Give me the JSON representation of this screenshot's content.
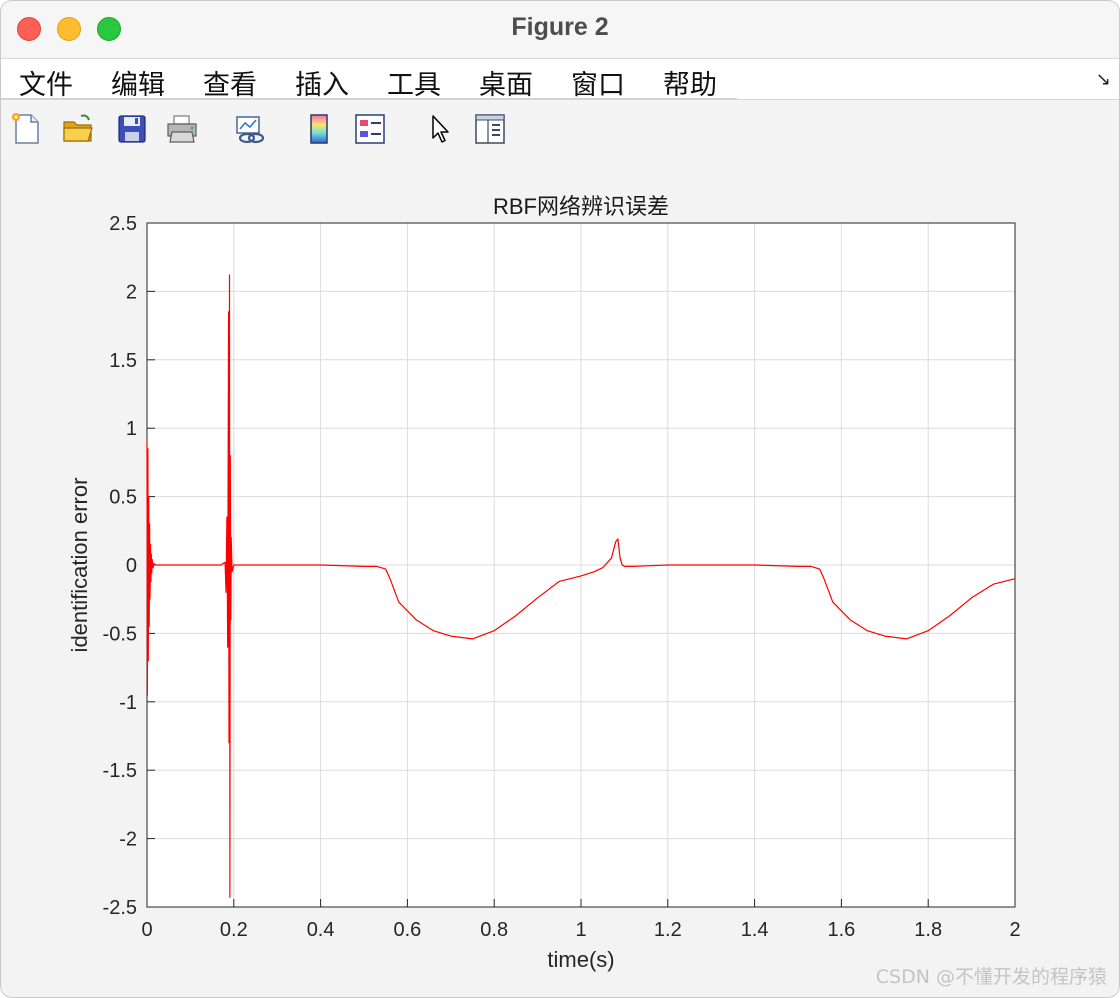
{
  "window": {
    "title": "Figure 2"
  },
  "menubar": {
    "items": [
      "文件",
      "编辑",
      "查看",
      "插入",
      "工具",
      "桌面",
      "窗口",
      "帮助"
    ],
    "corner_glyph": "↘"
  },
  "toolbar": {
    "icons": [
      "new-figure-icon",
      "open-file-icon",
      "save-icon",
      "print-icon",
      "link-plot-icon",
      "colorbar-icon",
      "legend-icon",
      "edit-plot-arrow-icon",
      "property-inspector-icon"
    ]
  },
  "watermark": "CSDN @不懂开发的程序猿",
  "chart_data": {
    "type": "line",
    "title": "RBF网络辨识误差",
    "xlabel": "time(s)",
    "ylabel": "identification error",
    "xlim": [
      0,
      2
    ],
    "ylim": [
      -2.5,
      2.5
    ],
    "xticks": [
      0,
      0.2,
      0.4,
      0.6,
      0.8,
      1,
      1.2,
      1.4,
      1.6,
      1.8,
      2
    ],
    "xtick_labels": [
      "0",
      "0.2",
      "0.4",
      "0.6",
      "0.8",
      "1",
      "1.2",
      "1.4",
      "1.6",
      "1.8",
      "2"
    ],
    "yticks": [
      -2.5,
      -2,
      -1.5,
      -1,
      -0.5,
      0,
      0.5,
      1,
      1.5,
      2,
      2.5
    ],
    "ytick_labels": [
      "-2.5",
      "-2",
      "-1.5",
      "-1",
      "-0.5",
      "0",
      "0.5",
      "1",
      "1.5",
      "2",
      "2.5"
    ],
    "grid": true,
    "series": [
      {
        "color": "#ff0000",
        "x": [
          0.0,
          0.001,
          0.002,
          0.003,
          0.004,
          0.005,
          0.006,
          0.007,
          0.008,
          0.009,
          0.01,
          0.011,
          0.012,
          0.014,
          0.016,
          0.02,
          0.05,
          0.1,
          0.17,
          0.18,
          0.182,
          0.184,
          0.186,
          0.187,
          0.188,
          0.189,
          0.19,
          0.191,
          0.192,
          0.193,
          0.194,
          0.196,
          0.2,
          0.3,
          0.4,
          0.5,
          0.53,
          0.55,
          0.56,
          0.58,
          0.62,
          0.66,
          0.7,
          0.75,
          0.8,
          0.85,
          0.9,
          0.95,
          1.0,
          1.03,
          1.05,
          1.07,
          1.08,
          1.085,
          1.09,
          1.095,
          1.1,
          1.12,
          1.2,
          1.3,
          1.4,
          1.5,
          1.53,
          1.55,
          1.56,
          1.58,
          1.62,
          1.66,
          1.7,
          1.75,
          1.8,
          1.85,
          1.9,
          1.95,
          2.0
        ],
        "y": [
          0.9,
          -0.95,
          0.85,
          -0.7,
          0.5,
          -0.45,
          0.3,
          -0.25,
          0.15,
          -0.12,
          0.08,
          -0.06,
          0.04,
          -0.02,
          0.01,
          0.0,
          0.0,
          0.0,
          0.0,
          0.02,
          -0.2,
          0.35,
          -0.6,
          0.9,
          1.85,
          -1.3,
          2.12,
          -2.43,
          0.8,
          -0.4,
          0.2,
          -0.05,
          0.0,
          0.0,
          0.0,
          -0.01,
          -0.01,
          -0.03,
          -0.1,
          -0.27,
          -0.4,
          -0.48,
          -0.52,
          -0.54,
          -0.48,
          -0.37,
          -0.24,
          -0.12,
          -0.08,
          -0.05,
          -0.02,
          0.05,
          0.17,
          0.19,
          0.05,
          0.0,
          -0.01,
          -0.01,
          0.0,
          0.0,
          0.0,
          -0.01,
          -0.01,
          -0.03,
          -0.1,
          -0.27,
          -0.4,
          -0.48,
          -0.52,
          -0.54,
          -0.48,
          -0.37,
          -0.24,
          -0.14,
          -0.1
        ]
      }
    ]
  }
}
